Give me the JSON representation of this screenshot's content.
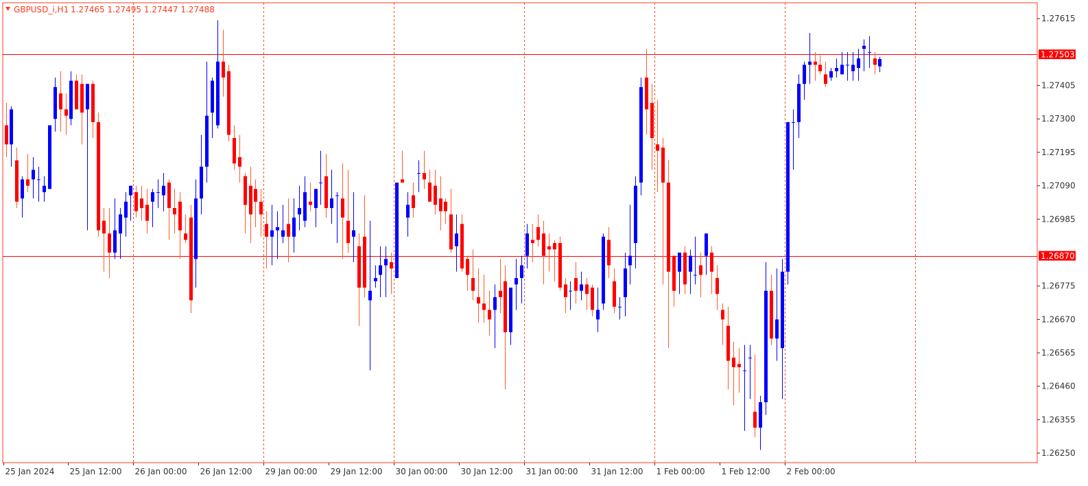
{
  "symbol_header": {
    "symbol": "GBPUSD_i,H1",
    "ohlc": "1.27465 1.27495 1.27447 1.27488"
  },
  "colors": {
    "bull": "#0000ff",
    "bear": "#ff0000",
    "wick_bull": "#0000ff",
    "wick_bear": "#ff5a2a",
    "grid": "#ff4a1a",
    "frame": "#ff3b1f",
    "text": "#333333",
    "level_line": "#ff0000",
    "tag_bg": "#ff0000"
  },
  "chart_data": {
    "type": "candlestick",
    "ylim": [
      1.2622,
      1.27665
    ],
    "y_ticks": [
      "1.27615",
      "1.27405",
      "1.27300",
      "1.27195",
      "1.27090",
      "1.26985",
      "1.26775",
      "1.26670",
      "1.26565",
      "1.26460",
      "1.26355",
      "1.26250"
    ],
    "x_labels": [
      {
        "label": "25 Jan 2024",
        "bar": 0
      },
      {
        "label": "25 Jan 12:00",
        "bar": 12
      },
      {
        "label": "26 Jan 00:00",
        "bar": 24
      },
      {
        "label": "26 Jan 12:00",
        "bar": 36
      },
      {
        "label": "29 Jan 00:00",
        "bar": 48
      },
      {
        "label": "29 Jan 12:00",
        "bar": 60
      },
      {
        "label": "30 Jan 00:00",
        "bar": 72
      },
      {
        "label": "30 Jan 12:00",
        "bar": 84
      },
      {
        "label": "31 Jan 00:00",
        "bar": 96
      },
      {
        "label": "31 Jan 12:00",
        "bar": 108
      },
      {
        "label": "1 Feb 00:00",
        "bar": 120
      },
      {
        "label": "1 Feb 12:00",
        "bar": 132
      },
      {
        "label": "2 Feb 00:00",
        "bar": 144
      }
    ],
    "grid_bars": [
      24,
      48,
      72,
      96,
      120,
      144,
      168
    ],
    "levels": [
      {
        "value": 1.27503,
        "label": "1.27503"
      },
      {
        "value": 1.2687,
        "label": "1.26870"
      }
    ],
    "current_price": 1.27488,
    "bars": [
      [
        1.2728,
        1.2735,
        1.2718,
        1.2722
      ],
      [
        1.2722,
        1.2734,
        1.2715,
        1.2733
      ],
      [
        1.2717,
        1.2721,
        1.2702,
        1.2704
      ],
      [
        1.2705,
        1.2712,
        1.2699,
        1.2711
      ],
      [
        1.2711,
        1.2719,
        1.2707,
        1.2709
      ],
      [
        1.2711,
        1.2718,
        1.2705,
        1.2714
      ],
      [
        1.2711,
        1.2715,
        1.2704,
        1.2711
      ],
      [
        1.2707,
        1.2712,
        1.2704,
        1.2709
      ],
      [
        1.2708,
        1.2716,
        1.2708,
        1.2728
      ],
      [
        1.273,
        1.2743,
        1.2726,
        1.274
      ],
      [
        1.2738,
        1.2745,
        1.2726,
        1.2733
      ],
      [
        1.2733,
        1.2738,
        1.2725,
        1.2731
      ],
      [
        1.273,
        1.2745,
        1.2728,
        1.2742
      ],
      [
        1.2742,
        1.2744,
        1.2733,
        1.2733
      ],
      [
        1.2741,
        1.2744,
        1.2722,
        1.2732
      ],
      [
        1.2733,
        1.2741,
        1.2695,
        1.2741
      ],
      [
        1.2741,
        1.2742,
        1.2724,
        1.2729
      ],
      [
        1.2729,
        1.2732,
        1.2693,
        1.2695
      ],
      [
        1.2698,
        1.2702,
        1.2682,
        1.2694
      ],
      [
        1.2694,
        1.2702,
        1.268,
        1.2688
      ],
      [
        1.2688,
        1.2705,
        1.2686,
        1.2695
      ],
      [
        1.2694,
        1.2702,
        1.2686,
        1.27
      ],
      [
        1.2699,
        1.2707,
        1.2693,
        1.2704
      ],
      [
        1.2706,
        1.2709,
        1.2698,
        1.2709
      ],
      [
        1.2707,
        1.2709,
        1.2699,
        1.2701
      ],
      [
        1.2705,
        1.2709,
        1.2698,
        1.2702
      ],
      [
        1.2703,
        1.2708,
        1.2694,
        1.2698
      ],
      [
        1.2704,
        1.2708,
        1.2696,
        1.2707
      ],
      [
        1.2707,
        1.2711,
        1.2702,
        1.2707
      ],
      [
        1.2706,
        1.2713,
        1.2701,
        1.2709
      ],
      [
        1.271,
        1.2711,
        1.2692,
        1.2702
      ],
      [
        1.2702,
        1.2708,
        1.2694,
        1.27
      ],
      [
        1.2704,
        1.2707,
        1.2686,
        1.2695
      ],
      [
        1.2694,
        1.27,
        1.2691,
        1.2692
      ],
      [
        1.2699,
        1.2703,
        1.2669,
        1.2673
      ],
      [
        1.2686,
        1.2711,
        1.2677,
        1.2705
      ],
      [
        1.2705,
        1.2725,
        1.27,
        1.2715
      ],
      [
        1.2715,
        1.2748,
        1.271,
        1.2731
      ],
      [
        1.2732,
        1.2743,
        1.2724,
        1.2742
      ],
      [
        1.2728,
        1.2761,
        1.2727,
        1.2748
      ],
      [
        1.2748,
        1.2758,
        1.2737,
        1.2743
      ],
      [
        1.2745,
        1.2747,
        1.2723,
        1.2725
      ],
      [
        1.2724,
        1.2728,
        1.2714,
        1.2716
      ],
      [
        1.2718,
        1.2725,
        1.271,
        1.2715
      ],
      [
        1.2712,
        1.2713,
        1.2694,
        1.2703
      ],
      [
        1.2709,
        1.2715,
        1.2691,
        1.27
      ],
      [
        1.2708,
        1.2711,
        1.2696,
        1.2704
      ],
      [
        1.2704,
        1.2708,
        1.2693,
        1.27
      ],
      [
        1.2697,
        1.2701,
        1.2683,
        1.2693
      ],
      [
        1.2693,
        1.2703,
        1.2684,
        1.2695
      ],
      [
        1.2695,
        1.2701,
        1.2686,
        1.2696
      ],
      [
        1.2693,
        1.2703,
        1.2691,
        1.2695
      ],
      [
        1.2697,
        1.2705,
        1.2685,
        1.2693
      ],
      [
        1.2693,
        1.2705,
        1.2688,
        1.2699
      ],
      [
        1.27,
        1.2709,
        1.2695,
        1.2702
      ],
      [
        1.2698,
        1.2712,
        1.2696,
        1.2707
      ],
      [
        1.2704,
        1.271,
        1.2701,
        1.2703
      ],
      [
        1.2702,
        1.2708,
        1.2696,
        1.2708
      ],
      [
        1.271,
        1.272,
        1.2703,
        1.271
      ],
      [
        1.2712,
        1.2719,
        1.2699,
        1.2702
      ],
      [
        1.2702,
        1.2714,
        1.2697,
        1.2705
      ],
      [
        1.2706,
        1.2707,
        1.2691,
        1.2706
      ],
      [
        1.2705,
        1.2716,
        1.2686,
        1.2699
      ],
      [
        1.2698,
        1.2714,
        1.2688,
        1.2691
      ],
      [
        1.2693,
        1.2707,
        1.2685,
        1.2695
      ],
      [
        1.269,
        1.2694,
        1.2665,
        1.2677
      ],
      [
        1.2693,
        1.2706,
        1.2674,
        1.2677
      ],
      [
        1.2673,
        1.2698,
        1.2651,
        1.2676
      ],
      [
        1.2679,
        1.2684,
        1.2677,
        1.268
      ],
      [
        1.2681,
        1.269,
        1.2674,
        1.2684
      ],
      [
        1.2684,
        1.269,
        1.2674,
        1.2686
      ],
      [
        1.2685,
        1.2688,
        1.2675,
        1.2683
      ],
      [
        1.268,
        1.2705,
        1.268,
        1.271
      ],
      [
        1.2711,
        1.272,
        1.271,
        1.271
      ],
      [
        1.2699,
        1.2707,
        1.2693,
        1.2703
      ],
      [
        1.2706,
        1.271,
        1.2699,
        1.2702
      ],
      [
        1.2713,
        1.2717,
        1.2707,
        1.2713
      ],
      [
        1.2713,
        1.272,
        1.2708,
        1.2711
      ],
      [
        1.271,
        1.2714,
        1.2704,
        1.2704
      ],
      [
        1.2709,
        1.2714,
        1.27,
        1.2703
      ],
      [
        1.2705,
        1.2712,
        1.2695,
        1.2701
      ],
      [
        1.2704,
        1.2705,
        1.2697,
        1.2701
      ],
      [
        1.27,
        1.2708,
        1.2688,
        1.2689
      ],
      [
        1.269,
        1.27,
        1.2682,
        1.2694
      ],
      [
        1.2697,
        1.27,
        1.2682,
        1.2683
      ],
      [
        1.2686,
        1.2687,
        1.2676,
        1.2681
      ],
      [
        1.268,
        1.2689,
        1.2673,
        1.2676
      ],
      [
        1.2674,
        1.2683,
        1.2666,
        1.2672
      ],
      [
        1.2672,
        1.2681,
        1.2666,
        1.267
      ],
      [
        1.267,
        1.2676,
        1.2662,
        1.2667
      ],
      [
        1.267,
        1.2678,
        1.2658,
        1.2674
      ],
      [
        1.2676,
        1.2686,
        1.2669,
        1.2674
      ],
      [
        1.2679,
        1.2684,
        1.2645,
        1.2663
      ],
      [
        1.2663,
        1.2677,
        1.2659,
        1.2677
      ],
      [
        1.2678,
        1.2686,
        1.267,
        1.268
      ],
      [
        1.268,
        1.2687,
        1.2672,
        1.2684
      ],
      [
        1.2687,
        1.2697,
        1.2683,
        1.2694
      ],
      [
        1.2692,
        1.2697,
        1.2685,
        1.2691
      ],
      [
        1.2696,
        1.27,
        1.269,
        1.2692
      ],
      [
        1.2694,
        1.2698,
        1.2678,
        1.2687
      ],
      [
        1.269,
        1.2694,
        1.2682,
        1.2689
      ],
      [
        1.2691,
        1.2692,
        1.2679,
        1.2689
      ],
      [
        1.2691,
        1.2693,
        1.2676,
        1.2677
      ],
      [
        1.2678,
        1.268,
        1.2669,
        1.2674
      ],
      [
        1.2676,
        1.2679,
        1.267,
        1.2676
      ],
      [
        1.268,
        1.2685,
        1.2672,
        1.2676
      ],
      [
        1.2676,
        1.2682,
        1.2673,
        1.2678
      ],
      [
        1.2678,
        1.268,
        1.267,
        1.2675
      ],
      [
        1.2677,
        1.2678,
        1.2668,
        1.267
      ],
      [
        1.2667,
        1.2677,
        1.2663,
        1.267
      ],
      [
        1.2672,
        1.2694,
        1.267,
        1.2693
      ],
      [
        1.2692,
        1.2696,
        1.268,
        1.2684
      ],
      [
        1.2679,
        1.2683,
        1.2669,
        1.2671
      ],
      [
        1.2671,
        1.2674,
        1.2667,
        1.2671
      ],
      [
        1.2674,
        1.2688,
        1.2668,
        1.2683
      ],
      [
        1.2684,
        1.2703,
        1.2678,
        1.2687
      ],
      [
        1.2691,
        1.2712,
        1.2683,
        1.2709
      ],
      [
        1.271,
        1.2743,
        1.2706,
        1.274
      ],
      [
        1.2743,
        1.2752,
        1.2725,
        1.2733
      ],
      [
        1.2735,
        1.2741,
        1.2714,
        1.2724
      ],
      [
        1.2722,
        1.2736,
        1.2707,
        1.272
      ],
      [
        1.2721,
        1.2724,
        1.2678,
        1.271
      ],
      [
        1.271,
        1.2717,
        1.2658,
        1.2682
      ],
      [
        1.2687,
        1.2687,
        1.2671,
        1.2676
      ],
      [
        1.2682,
        1.2688,
        1.2675,
        1.2688
      ],
      [
        1.2688,
        1.269,
        1.2675,
        1.2678
      ],
      [
        1.2682,
        1.2689,
        1.2675,
        1.2687
      ],
      [
        1.2681,
        1.2693,
        1.2678,
        1.2681
      ],
      [
        1.2684,
        1.2688,
        1.2674,
        1.2681
      ],
      [
        1.2687,
        1.2693,
        1.2681,
        1.2694
      ],
      [
        1.2688,
        1.269,
        1.2675,
        1.2682
      ],
      [
        1.268,
        1.2684,
        1.267,
        1.2675
      ],
      [
        1.267,
        1.2672,
        1.2659,
        1.2667
      ],
      [
        1.2665,
        1.2671,
        1.2645,
        1.2654
      ],
      [
        1.2655,
        1.266,
        1.264,
        1.2652
      ],
      [
        1.2653,
        1.2658,
        1.2644,
        1.2652
      ],
      [
        1.2651,
        1.2659,
        1.2632,
        1.2651
      ],
      [
        1.2655,
        1.2659,
        1.2642,
        1.2655
      ],
      [
        1.2638,
        1.2656,
        1.263,
        1.2633
      ],
      [
        1.2633,
        1.2643,
        1.2626,
        1.2641
      ],
      [
        1.2641,
        1.2685,
        1.2637,
        1.2676
      ],
      [
        1.2676,
        1.2681,
        1.2659,
        1.2661
      ],
      [
        1.2661,
        1.2683,
        1.2654,
        1.2667
      ],
      [
        1.2658,
        1.2686,
        1.2642,
        1.2682
      ],
      [
        1.2682,
        1.272,
        1.2678,
        1.2729
      ],
      [
        1.2729,
        1.2733,
        1.2714,
        1.2729
      ],
      [
        1.2729,
        1.2744,
        1.2724,
        1.2741
      ],
      [
        1.2741,
        1.2748,
        1.2736,
        1.2747
      ],
      [
        1.2747,
        1.2757,
        1.2741,
        1.2748
      ],
      [
        1.2748,
        1.2751,
        1.2742,
        1.2747
      ],
      [
        1.2747,
        1.275,
        1.2744,
        1.2745
      ],
      [
        1.2744,
        1.2748,
        1.274,
        1.2741
      ],
      [
        1.2743,
        1.2746,
        1.2742,
        1.2745
      ],
      [
        1.2745,
        1.2749,
        1.2743,
        1.2746
      ],
      [
        1.2744,
        1.2751,
        1.2744,
        1.2747
      ],
      [
        1.2747,
        1.2751,
        1.2742,
        1.2747
      ],
      [
        1.2745,
        1.2751,
        1.2742,
        1.2747
      ],
      [
        1.2746,
        1.2752,
        1.2742,
        1.2749
      ],
      [
        1.2752,
        1.2755,
        1.2745,
        1.2753
      ],
      [
        1.2751,
        1.2756,
        1.2746,
        1.2751
      ],
      [
        1.2749,
        1.2751,
        1.2744,
        1.2747
      ],
      [
        1.27465,
        1.27495,
        1.27447,
        1.27488
      ]
    ]
  }
}
